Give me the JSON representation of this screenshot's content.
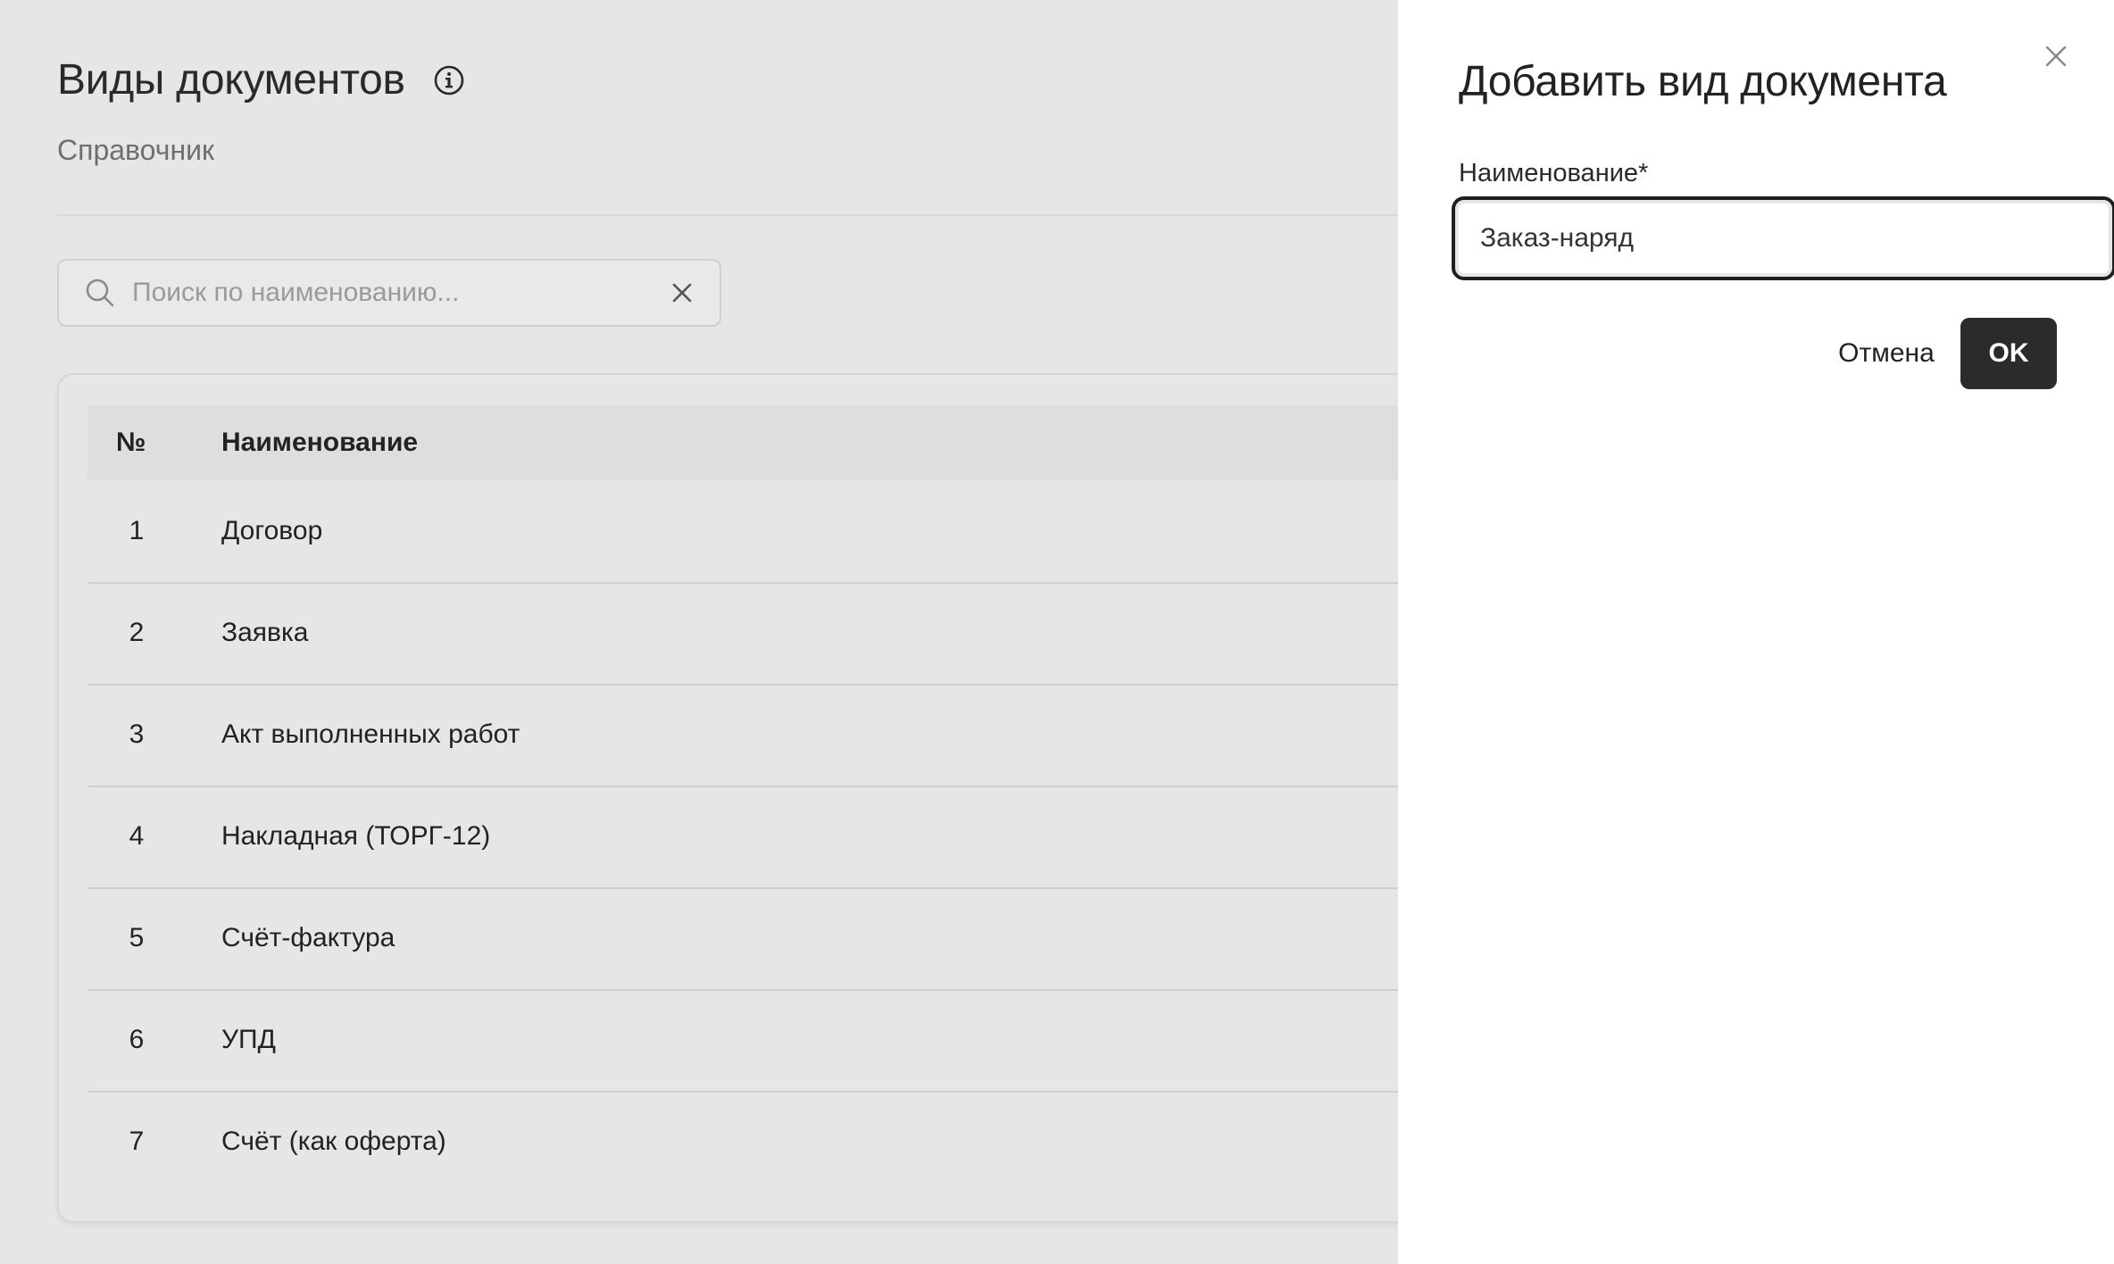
{
  "header": {
    "title": "Виды документов",
    "subtitle": "Справочник",
    "info_icon": "info-icon"
  },
  "search": {
    "placeholder": "Поиск по наименованию...",
    "value": ""
  },
  "table": {
    "columns": [
      "№",
      "Наименование"
    ],
    "rows": [
      {
        "num": "1",
        "name": "Договор"
      },
      {
        "num": "2",
        "name": "Заявка"
      },
      {
        "num": "3",
        "name": "Акт выполненных работ"
      },
      {
        "num": "4",
        "name": "Накладная (ТОРГ-12)"
      },
      {
        "num": "5",
        "name": "Счёт-фактура"
      },
      {
        "num": "6",
        "name": "УПД"
      },
      {
        "num": "7",
        "name": "Счёт (как оферта)"
      }
    ]
  },
  "panel": {
    "title": "Добавить вид документа",
    "field_label": "Наименование*",
    "field_value": "Заказ-наряд",
    "cancel_label": "Отмена",
    "ok_label": "OK"
  },
  "colors": {
    "background": "#e6e6e6",
    "panel": "#ffffff",
    "primary_button": "#2b2b2b",
    "text": "#222222"
  }
}
